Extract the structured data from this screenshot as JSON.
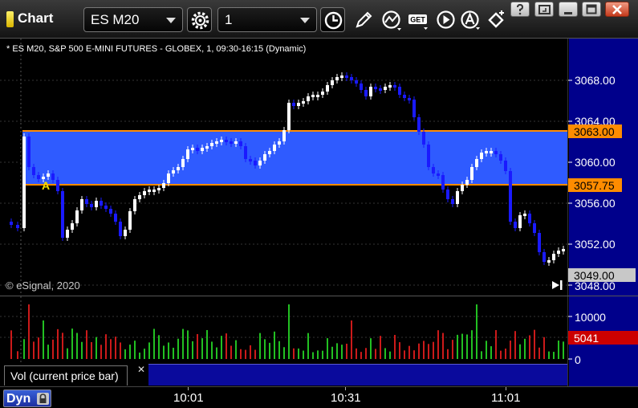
{
  "window": {
    "title": "Chart",
    "symbol": "ES M20",
    "interval": "1",
    "toolbar_icons": [
      "settings-icon",
      "clock-icon",
      "pencil-icon",
      "indicator-icon",
      "get-icon",
      "play-icon",
      "alert-icon",
      "link-icon"
    ],
    "window_controls": [
      "help-icon",
      "restore-icon",
      "minimize-icon",
      "maximize-icon",
      "close-icon"
    ],
    "get_badge": "GET"
  },
  "chart": {
    "caption": "* ES M20, S&P 500 E-MINI FUTURES - GLOBEX, 1, 09:30-16:15 (Dynamic)",
    "watermark": "© eSignal, 2020",
    "price_axis_ticks": [
      "3068.00",
      "3064.00",
      "3060.00",
      "3056.00",
      "3052.00",
      "3048.00"
    ],
    "upper_level_label": "3063.00",
    "lower_level_label": "3057.75",
    "last_price_label": "3049.00",
    "annotation_marker": "A",
    "colors": {
      "up_candle": "#ffffff",
      "down_candle": "#1a1aff",
      "range_band": "#2f5bff",
      "level_line": "#ff8c00",
      "price_axis_bg": "#00008b"
    }
  },
  "volume": {
    "study_label": "Vol (current price bar)",
    "axis_ticks": [
      "10000",
      "5000",
      "0"
    ],
    "last_volume_label": "5041",
    "colors": {
      "up_bar": "#22c022",
      "down_bar": "#cc1a1a",
      "last_label_bg": "#cc0000"
    }
  },
  "time_axis": {
    "mode_label": "Dyn",
    "ticks": [
      "10:01",
      "10:31",
      "11:01"
    ]
  }
}
